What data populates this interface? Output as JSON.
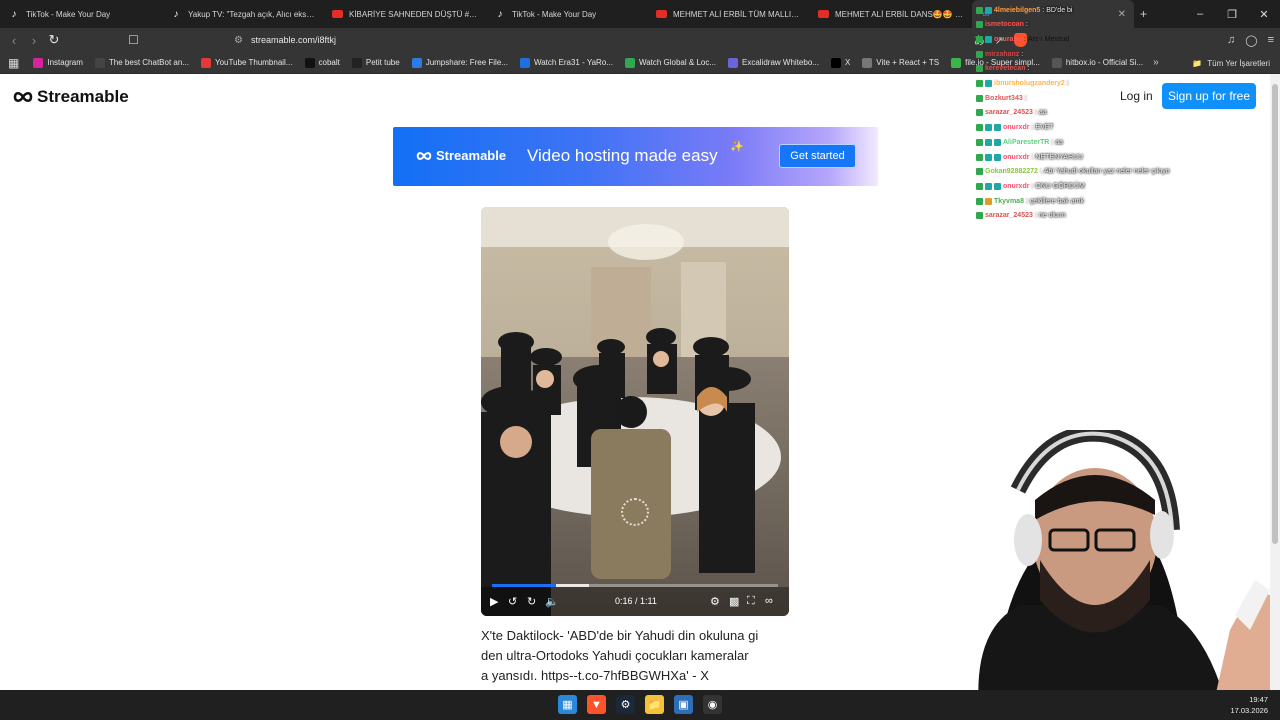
{
  "tabs": [
    {
      "title": "TikTok - Make Your Day",
      "icon": "tiktok-icon",
      "active": false
    },
    {
      "title": "Yakup TV: \"Tezgah açık, Alıcı eksik!\" -",
      "icon": "tiktok-icon",
      "active": false
    },
    {
      "title": "KİBARİYE SAHNEDEN DÜŞTÜ #KİBARİ",
      "icon": "youtube-icon",
      "active": false
    },
    {
      "title": "TikTok - Make Your Day",
      "icon": "tiktok-icon",
      "active": false
    },
    {
      "title": "MEHMET ALİ ERBİL TÜM MALLIKLAR",
      "icon": "youtube-icon",
      "active": false
    },
    {
      "title": "MEHMET ALİ ERBİL DANS🤩🤩 - Yo",
      "icon": "youtube-icon",
      "active": false
    },
    {
      "title": "streamable.com",
      "icon": "streamable-icon",
      "active": true
    }
  ],
  "address": {
    "url": "streamable.com/i8ftkj"
  },
  "bookmarks": [
    {
      "label": "Instagram",
      "icon": "instagram-icon",
      "color": "#d6249f"
    },
    {
      "label": "The best ChatBot an...",
      "icon": "chatbot-icon",
      "color": "#444444"
    },
    {
      "label": "YouTube Thumbnail...",
      "icon": "thumbnail-icon",
      "color": "#e53935"
    },
    {
      "label": "cobalt",
      "icon": "cobalt-icon",
      "color": "#111111"
    },
    {
      "label": "Petit tube",
      "icon": "petit-tube-icon",
      "color": "#222222"
    },
    {
      "label": "Jumpshare: Free File...",
      "icon": "jumpshare-icon",
      "color": "#2e7be5"
    },
    {
      "label": "Watch Era31 - YaRo...",
      "icon": "era31-icon",
      "color": "#1f6fe0"
    },
    {
      "label": "Watch Global & Loc...",
      "icon": "global-icon",
      "color": "#2fa84f"
    },
    {
      "label": "Excalidraw Whitebo...",
      "icon": "excalidraw-icon",
      "color": "#6965db"
    },
    {
      "label": "X",
      "icon": "x-icon",
      "color": "#000000"
    },
    {
      "label": "Vite + React + TS",
      "icon": "vite-icon",
      "color": "#777777"
    },
    {
      "label": "file.io - Super simpl...",
      "icon": "fileio-icon",
      "color": "#3bb54a"
    },
    {
      "label": "hitbox.io - Official Si...",
      "icon": "hitbox-icon",
      "color": "#555555"
    }
  ],
  "all_bookmarks": "Tüm Yer İşaretleri",
  "site": {
    "logo": "Streamable",
    "login": "Log in",
    "signup": "Sign up for free"
  },
  "banner": {
    "logo": "Streamable",
    "tagline": "Video hosting made easy",
    "cta": "Get started"
  },
  "player": {
    "time": "0:16 / 1:11",
    "played_fraction": 0.225,
    "buffered_fraction": 0.34
  },
  "caption": "X'te Daktilock- 'ABD'de bir Yahudi din okuluna gi den ultra-Ortodoks Yahudi çocukları kameralar a yansıdı. https--t.co-7hfBBGWHXa' - X",
  "caption_lines": [
    "X'te Daktilock- 'ABD'de bir Yahudi din okuluna gi",
    "den ultra-Ortodoks Yahudi çocukları kameralar",
    "a yansıdı. https--t.co-7hfBBGWHXa' - X"
  ],
  "chat": [
    {
      "name": "4lmeiebilgen5",
      "name_color": "#ff9a3c",
      "message": "BD'de bi",
      "badges": [
        "g",
        "t"
      ],
      "dark": false
    },
    {
      "name": "ismetocoan",
      "name_color": "#ff4d4d",
      "message": "",
      "badges": [
        "g"
      ],
      "dark": false
    },
    {
      "name": "onuraslr",
      "name_color": "#ff5a5a",
      "message": "Arz-ı Mevzud",
      "badges": [
        "g",
        "t"
      ],
      "dark": true
    },
    {
      "name": "mirzahanz",
      "name_color": "#d94040",
      "message": "",
      "badges": [
        "g"
      ],
      "dark": false
    },
    {
      "name": "kerevetecan",
      "name_color": "#e04a4a",
      "message": "",
      "badges": [
        "g"
      ],
      "dark": false
    },
    {
      "name": "ibnursholugzandery2",
      "name_color": "#ffb347",
      "message": "",
      "badges": [
        "g",
        "t"
      ],
      "dark": false
    },
    {
      "name": "Bozkurt343",
      "name_color": "#e05656",
      "message": "",
      "badges": [
        "g"
      ],
      "dark": false
    },
    {
      "name": "sarazar_24523",
      "name_color": "#d9534f",
      "message": "aa",
      "badges": [
        "g"
      ],
      "dark": false
    },
    {
      "name": "onurxdr",
      "name_color": "#ff4d6d",
      "message": "EVET",
      "badges": [
        "g",
        "t",
        "t"
      ],
      "dark": false
    },
    {
      "name": "AliParesterTR",
      "name_color": "#55d27a",
      "message": "aa",
      "badges": [
        "g",
        "t",
        "t"
      ],
      "dark": false
    },
    {
      "name": "onurxdr",
      "name_color": "#ff4d6d",
      "message": "NETENYAHUU",
      "badges": [
        "g",
        "t",
        "t"
      ],
      "dark": false
    },
    {
      "name": "Gokan92882272",
      "name_color": "#8bc34a",
      "message": "Abi Yahudi okulları yaz neler neler çıkıyo",
      "badges": [
        "g"
      ],
      "dark": false
    },
    {
      "name": "onurxdr",
      "name_color": "#ff4d6d",
      "message": "ONU GÖRDÜM",
      "badges": [
        "g",
        "t",
        "t"
      ],
      "dark": false
    },
    {
      "name": "Tkyvma8",
      "name_color": "#4caf50",
      "message": "çekillere bak amk",
      "badges": [
        "g",
        "o"
      ],
      "dark": false
    },
    {
      "name": "sarazar_24523",
      "name_color": "#d9534f",
      "message": "ne oluıın",
      "badges": [
        "g"
      ],
      "dark": false
    }
  ],
  "clock": {
    "time": "19:47",
    "date": "17.03.2026"
  }
}
